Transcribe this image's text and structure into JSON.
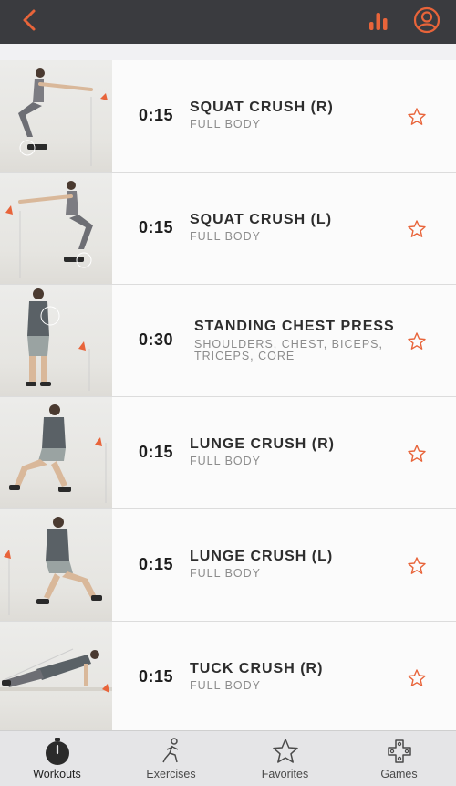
{
  "colors": {
    "accent": "#e8643a",
    "topbar": "#3a3b3f"
  },
  "header": {
    "back_icon": "chevron-left-icon",
    "stats_icon": "bar-chart-icon",
    "profile_icon": "user-circle-icon"
  },
  "exercises": [
    {
      "duration": "0:15",
      "name": "SQUAT CRUSH (R)",
      "category": "FULL BODY"
    },
    {
      "duration": "0:15",
      "name": "SQUAT CRUSH (L)",
      "category": "FULL BODY"
    },
    {
      "duration": "0:30",
      "name": "STANDING CHEST PRESS",
      "category": "SHOULDERS, CHEST, BICEPS, TRICEPS, CORE"
    },
    {
      "duration": "0:15",
      "name": "LUNGE CRUSH (R)",
      "category": "FULL BODY"
    },
    {
      "duration": "0:15",
      "name": "LUNGE CRUSH (L)",
      "category": "FULL BODY"
    },
    {
      "duration": "0:15",
      "name": "TUCK CRUSH (R)",
      "category": "FULL BODY"
    }
  ],
  "tabs": [
    {
      "label": "Workouts",
      "icon": "stopwatch-icon",
      "active": true
    },
    {
      "label": "Exercises",
      "icon": "figure-exercise-icon",
      "active": false
    },
    {
      "label": "Favorites",
      "icon": "star-outline-icon",
      "active": false
    },
    {
      "label": "Games",
      "icon": "gamepad-icon",
      "active": false
    }
  ]
}
